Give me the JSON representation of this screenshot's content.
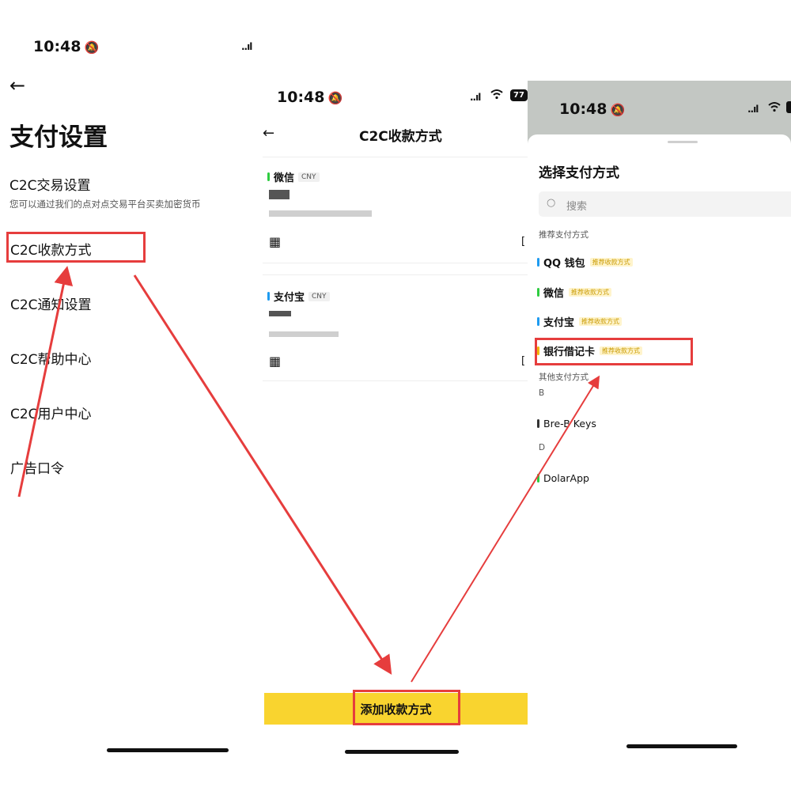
{
  "panel1": {
    "time": "10:48",
    "signal": "..ıl",
    "title": "支付设置",
    "trade_settings": {
      "label": "C2C交易设置",
      "description": "您可以通过我们的点对点交易平台买卖加密货币"
    },
    "menu": [
      {
        "label": "C2C收款方式"
      },
      {
        "label": "C2C通知设置"
      },
      {
        "label": "C2C帮助中心"
      },
      {
        "label": "C2C用户中心"
      },
      {
        "label": "广告口令"
      }
    ]
  },
  "panel2": {
    "time": "10:48",
    "title": "C2C收款方式",
    "battery": "77",
    "methods": [
      {
        "name": "微信",
        "currency": "CNY",
        "bar_color": "#2ecc40"
      },
      {
        "name": "支付宝",
        "currency": "CNY",
        "bar_color": "#1e9bf0"
      }
    ],
    "add_button": "添加收款方式",
    "accent": "#f9d42f"
  },
  "panel3": {
    "time": "10:48",
    "sheet_title": "选择支付方式",
    "search_placeholder": "搜索",
    "recommended_header": "推荐支付方式",
    "recommended": [
      {
        "name": "QQ 钱包",
        "tag": "推荐收款方式",
        "bar_color": "#1e9bf0"
      },
      {
        "name": "微信",
        "tag": "推荐收款方式",
        "bar_color": "#2ecc40"
      },
      {
        "name": "支付宝",
        "tag": "推荐收款方式",
        "bar_color": "#1e9bf0"
      },
      {
        "name": "银行借记卡",
        "tag": "推荐收款方式",
        "bar_color": "#f2b705"
      }
    ],
    "other_header": "其他支付方式",
    "groups": [
      {
        "letter": "B",
        "items": [
          {
            "name": "Bre-B Keys",
            "bar_color": "#333333"
          }
        ]
      },
      {
        "letter": "D",
        "items": [
          {
            "name": "DolarApp",
            "bar_color": "#2ecc40"
          }
        ]
      }
    ]
  },
  "colors": {
    "highlight_red": "#e63d3d",
    "tag_yellow": "#c99a00"
  }
}
